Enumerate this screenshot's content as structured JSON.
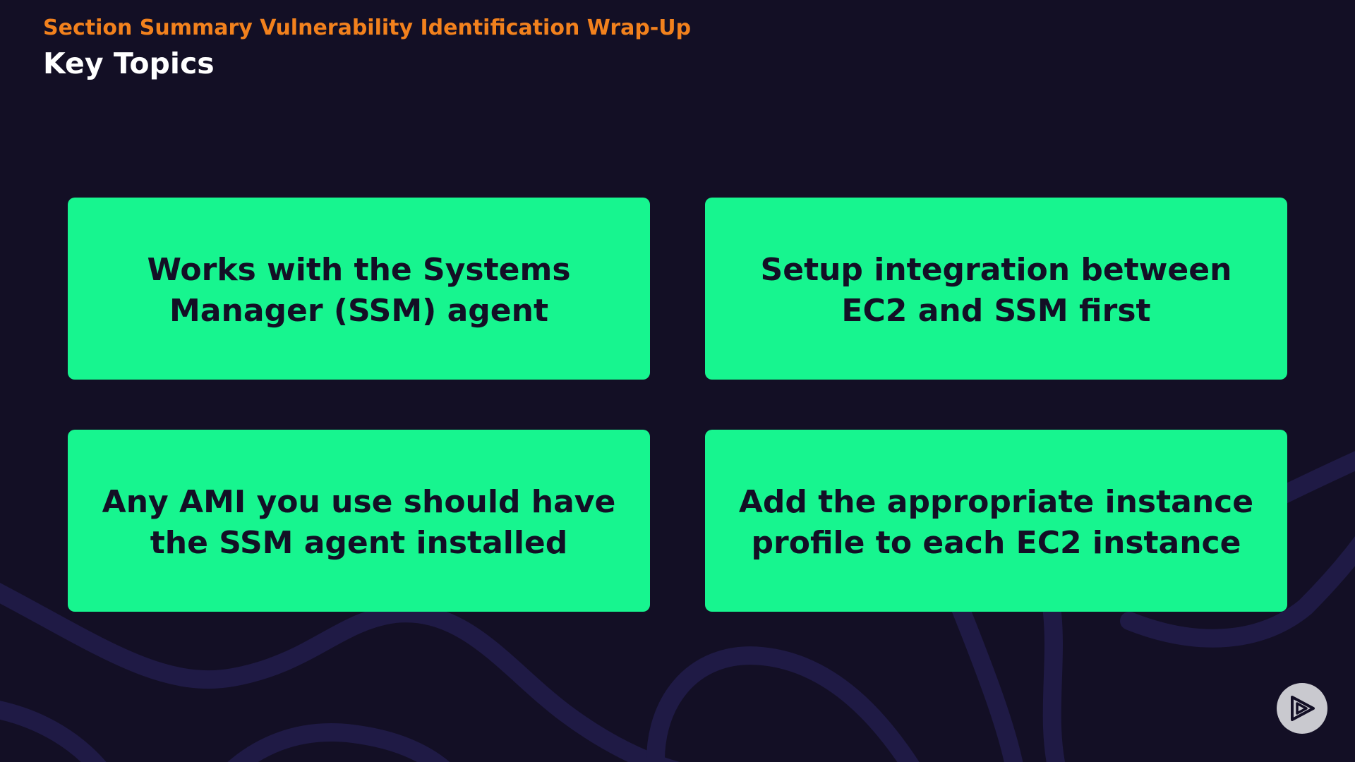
{
  "header": {
    "section_title": "Section Summary Vulnerability Identification Wrap-Up",
    "page_title": "Key Topics"
  },
  "cards": [
    {
      "text": "Works with the Systems Manager (SSM) agent"
    },
    {
      "text": "Setup integration between EC2 and SSM first"
    },
    {
      "text": "Any AMI you use should have the SSM agent installed"
    },
    {
      "text": "Add the appropriate instance profile to each EC2 instance"
    }
  ],
  "controls": {
    "play_icon": "play-logo-icon"
  },
  "colors": {
    "background": "#130f25",
    "accent_orange": "#f2811d",
    "card_green": "#17f58f",
    "title_white": "#ffffff"
  }
}
